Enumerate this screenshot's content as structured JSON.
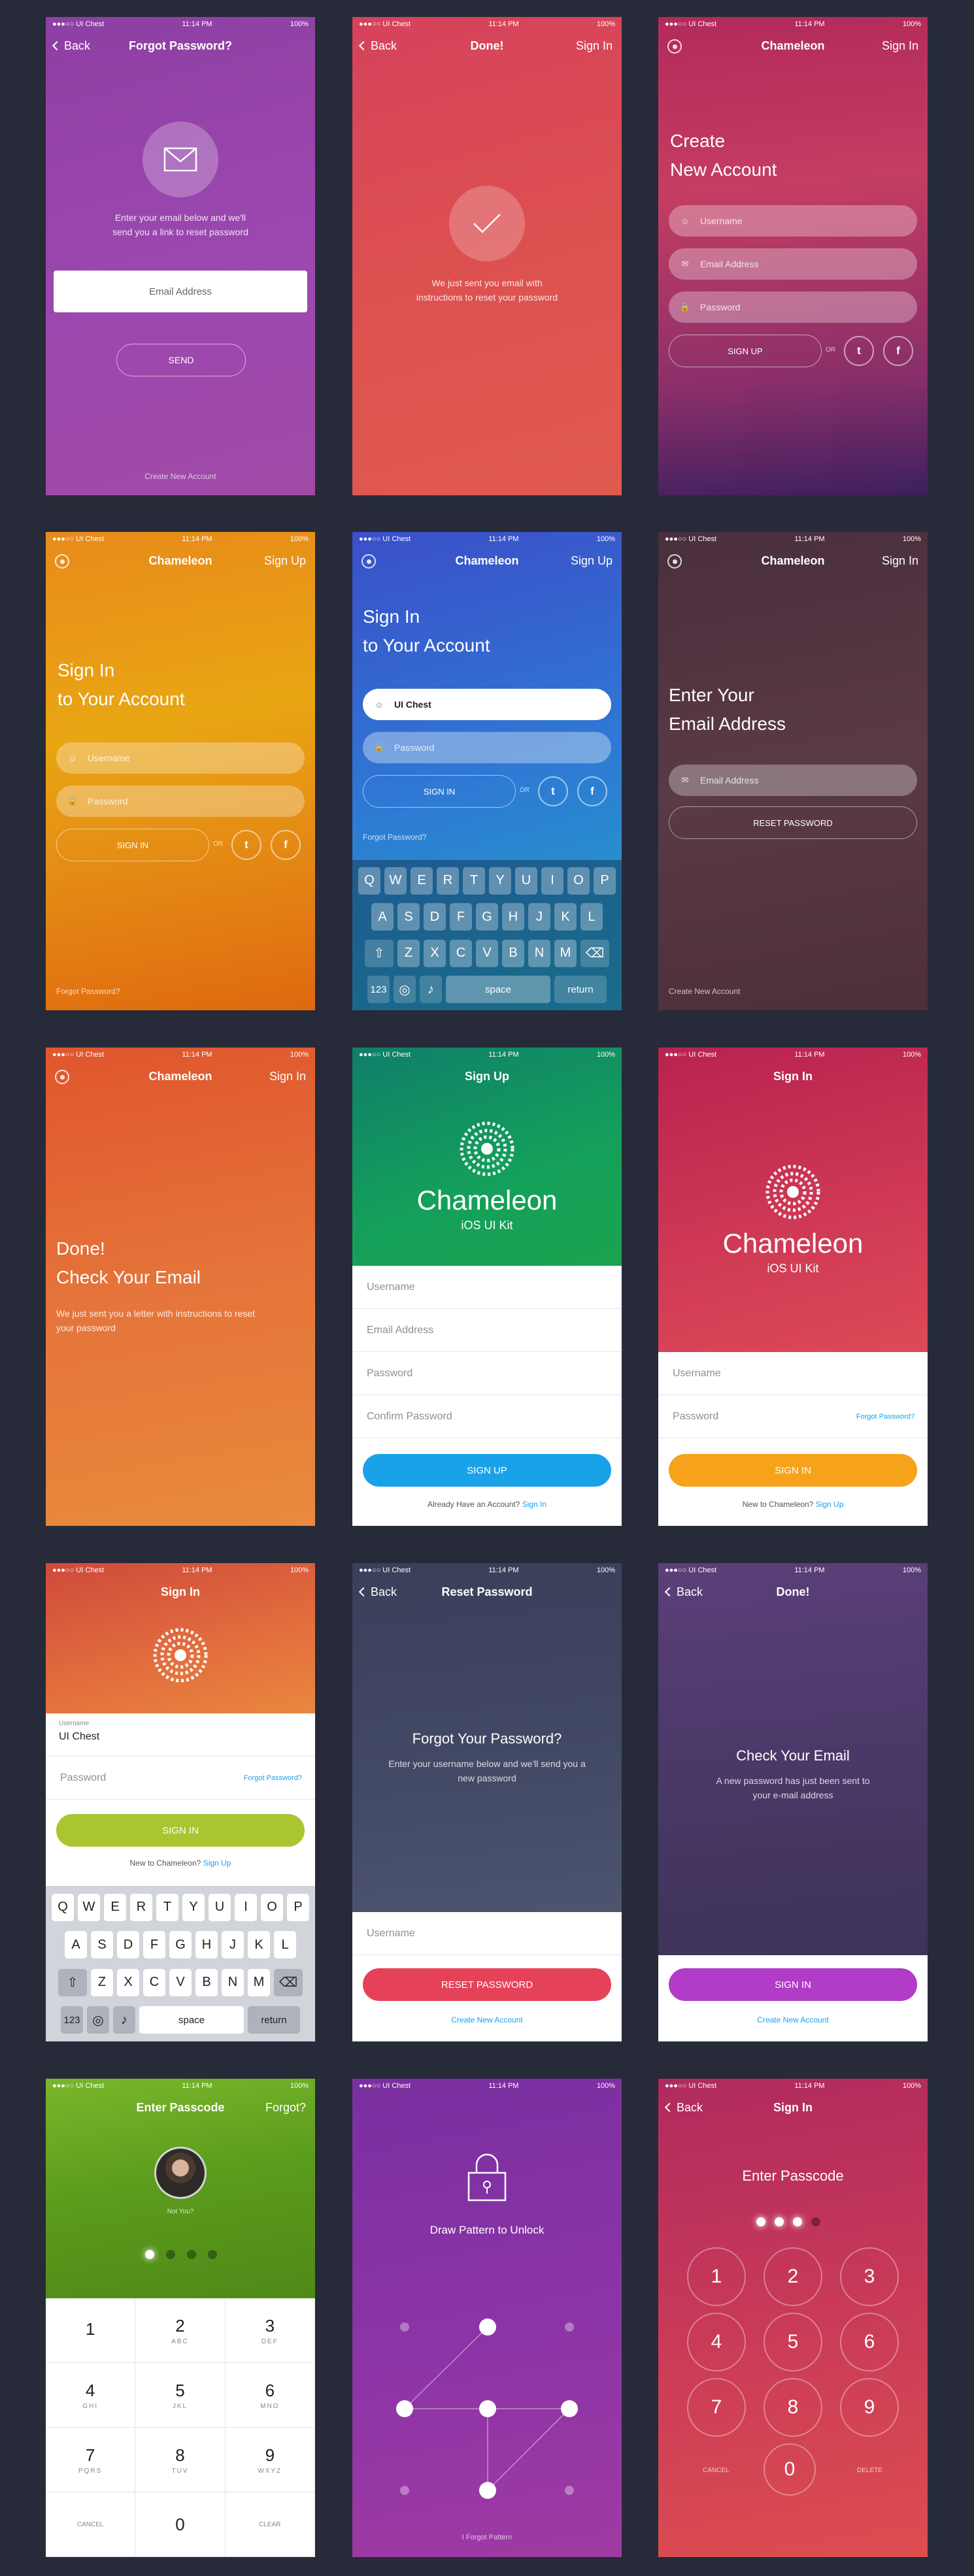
{
  "status": {
    "carrier": "●●●○○ UI Chest",
    "wifi": "≈",
    "time": "11:14 PM",
    "battery": "100%"
  },
  "s1": {
    "back": "Back",
    "title": "Forgot Password?",
    "desc": "Enter your email below and we'll send you a link to reset password",
    "email_ph": "Email Address",
    "send": "SEND",
    "footer": "Create New Account",
    "icon": "envelope-icon"
  },
  "s2": {
    "back": "Back",
    "title": "Done!",
    "right": "Sign In",
    "desc": "We just sent you email with instructions to reset your password",
    "icon": "checkmark-icon"
  },
  "s3": {
    "title": "Chameleon",
    "right": "Sign In",
    "heading": "Create\nNew Account",
    "username": "Username",
    "email": "Email Address",
    "password": "Password",
    "signup": "SIGN UP",
    "or": "OR"
  },
  "s4": {
    "title": "Chameleon",
    "right": "Sign Up",
    "heading": "Sign In\nto Your Account",
    "username": "Username",
    "password": "Password",
    "signin": "SIGN IN",
    "or": "OR",
    "footer": "Forgot Password?"
  },
  "s5": {
    "title": "Chameleon",
    "right": "Sign Up",
    "heading": "Sign In\nto Your Account",
    "username": "UI Chest",
    "password": "Password",
    "signin": "SIGN IN",
    "or": "OR",
    "forgot": "Forgot Password?"
  },
  "keyboard": {
    "row1": [
      "Q",
      "W",
      "E",
      "R",
      "T",
      "Y",
      "U",
      "I",
      "O",
      "P"
    ],
    "row2": [
      "A",
      "S",
      "D",
      "F",
      "G",
      "H",
      "J",
      "K",
      "L"
    ],
    "row3": [
      "Z",
      "X",
      "C",
      "V",
      "B",
      "N",
      "M"
    ],
    "num": "123",
    "space": "space",
    "ret": "return"
  },
  "s6": {
    "title": "Chameleon",
    "right": "Sign In",
    "heading": "Enter Your\nEmail Address",
    "email": "Email Address",
    "reset": "RESET PASSWORD",
    "footer": "Create New Account"
  },
  "s7": {
    "title": "Chameleon",
    "right": "Sign In",
    "heading": "Done!\nCheck Your Email",
    "desc": "We just sent you a letter with instructions to reset your password"
  },
  "s8": {
    "title": "Sign Up",
    "brand": "Chameleon",
    "sub": "iOS UI Kit",
    "fields": [
      "Username",
      "Email Address",
      "Password",
      "Confirm Password"
    ],
    "signup": "SIGN UP",
    "already": "Already Have an Account?",
    "signin_link": "Sign In"
  },
  "s9": {
    "title": "Sign In",
    "brand": "Chameleon",
    "sub": "iOS UI Kit",
    "username": "Username",
    "password": "Password",
    "forgot": "Forgot Password?",
    "signin": "SIGN IN",
    "new": "New to Chameleon?",
    "signup_link": "Sign Up"
  },
  "s10": {
    "title": "Sign In",
    "ulabel": "Username",
    "uvalue": "UI Chest",
    "password": "Password",
    "forgot": "Forgot Password?",
    "signin": "SIGN IN",
    "new": "New to Chameleon?",
    "signup_link": "Sign Up"
  },
  "s11": {
    "back": "Back",
    "title": "Reset Password",
    "heading": "Forgot Your Password?",
    "desc": "Enter your username below and we'll send you a new password",
    "username": "Username",
    "reset": "RESET PASSWORD",
    "create": "Create New Account"
  },
  "s12": {
    "back": "Back",
    "title": "Done!",
    "heading": "Check Your Email",
    "desc": "A new password has just been sent to your e-mail address",
    "signin": "SIGN IN",
    "create": "Create New Account"
  },
  "s13": {
    "title": "Enter Passcode",
    "right": "Forgot?",
    "notyou": "Not You?",
    "keys": [
      {
        "n": "1",
        "l": ""
      },
      {
        "n": "2",
        "l": "ABC"
      },
      {
        "n": "3",
        "l": "DEF"
      },
      {
        "n": "4",
        "l": "GHI"
      },
      {
        "n": "5",
        "l": "JKL"
      },
      {
        "n": "6",
        "l": "MNO"
      },
      {
        "n": "7",
        "l": "PQRS"
      },
      {
        "n": "8",
        "l": "TUV"
      },
      {
        "n": "9",
        "l": "WXYZ"
      },
      {
        "n": "CANCEL",
        "l": ""
      },
      {
        "n": "0",
        "l": ""
      },
      {
        "n": "CLEAR",
        "l": ""
      }
    ]
  },
  "s14": {
    "heading": "Draw Pattern to Unlock",
    "footer": "I Forgot Pattern",
    "icon": "lock-icon"
  },
  "s15": {
    "back": "Back",
    "title": "Sign In",
    "heading": "Enter Passcode",
    "digits": [
      "1",
      "2",
      "3",
      "4",
      "5",
      "6",
      "7",
      "8",
      "9",
      "0"
    ],
    "cancel": "CANCEL",
    "delete": "DELETE"
  }
}
